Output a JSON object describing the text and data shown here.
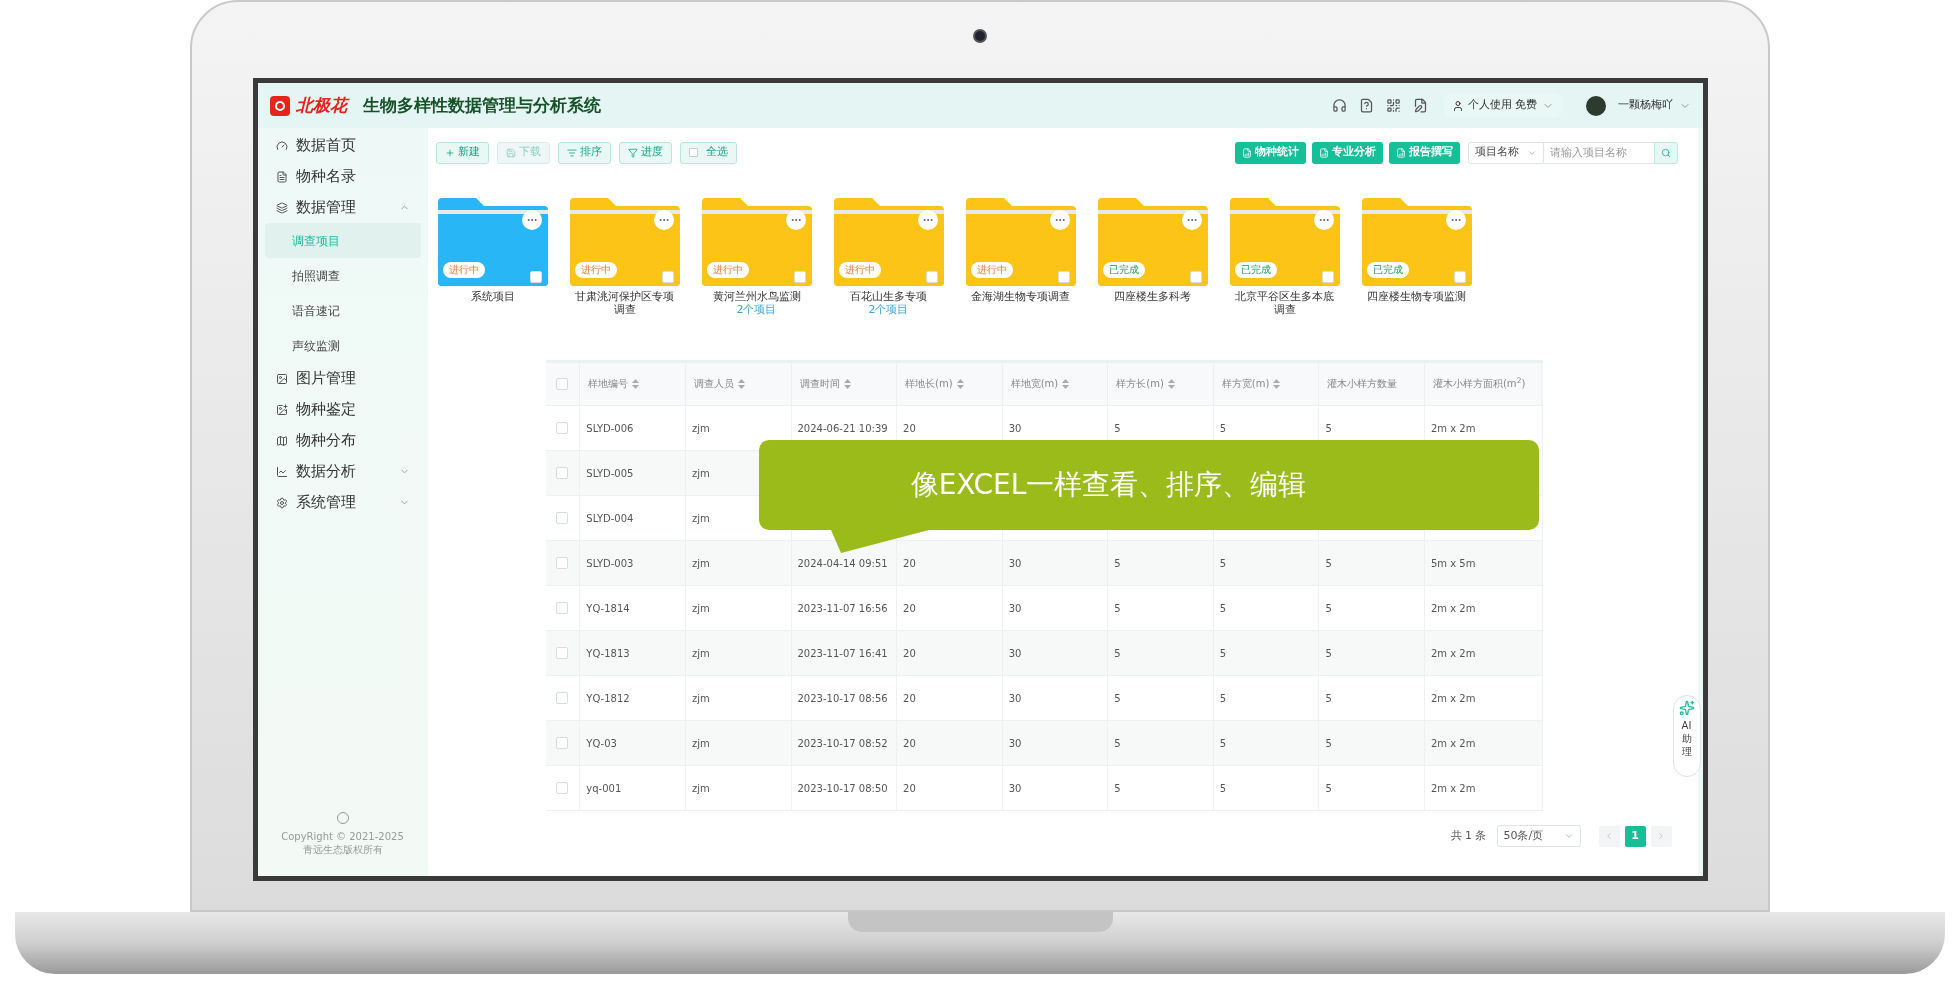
{
  "header": {
    "brand": "北极花",
    "title": "生物多样性数据管理与分析系统",
    "plan": "个人使用 免费",
    "user": "一颗杨梅吖"
  },
  "sidebar": {
    "items": [
      {
        "kind": "link",
        "label": "数据首页"
      },
      {
        "kind": "link",
        "label": "物种名录"
      },
      {
        "kind": "group",
        "label": "数据管理",
        "expanded": true,
        "children": [
          {
            "label": "调查项目",
            "selected": true
          },
          {
            "label": "拍照调查",
            "selected": false
          },
          {
            "label": "语音速记",
            "selected": false
          },
          {
            "label": "声纹监测",
            "selected": false
          }
        ]
      },
      {
        "kind": "link",
        "label": "图片管理"
      },
      {
        "kind": "link",
        "label": "物种鉴定"
      },
      {
        "kind": "link",
        "label": "物种分布"
      },
      {
        "kind": "group",
        "label": "数据分析",
        "expanded": false
      },
      {
        "kind": "group",
        "label": "系统管理",
        "expanded": false
      }
    ],
    "footer": [
      "CopyRight © 2021-2025",
      "青远生态版权所有"
    ]
  },
  "toolbar": {
    "buttons": [
      {
        "label": "新建",
        "disabled": false
      },
      {
        "label": "下载",
        "disabled": true
      },
      {
        "label": "排序",
        "disabled": false
      },
      {
        "label": "进度",
        "disabled": false
      }
    ],
    "select_all": {
      "label": "全选",
      "checked": false
    },
    "actions": [
      "物种统计",
      "专业分析",
      "报告撰写"
    ],
    "search": {
      "scope": "项目名称",
      "placeholder": "请输入项目名称"
    }
  },
  "folders": [
    {
      "name": "系统项目",
      "color": "#29b6f6",
      "status": "进行中",
      "kind": "in_progress",
      "checked": false
    },
    {
      "name": "甘肃洮河保护区专项调查",
      "color": "#fbc417",
      "status": "进行中",
      "kind": "in_progress",
      "checked": false
    },
    {
      "name": "黄河兰州水鸟监测",
      "sub": "2个项目",
      "color": "#fbc417",
      "status": "进行中",
      "kind": "in_progress",
      "checked": false
    },
    {
      "name": "百花山生多专项",
      "sub": "2个项目",
      "color": "#fbc417",
      "status": "进行中",
      "kind": "in_progress",
      "checked": false
    },
    {
      "name": "金海湖生物专项调查",
      "color": "#fbc417",
      "status": "进行中",
      "kind": "in_progress",
      "checked": false
    },
    {
      "name": "四座楼生多科考",
      "color": "#fbc417",
      "status": "已完成",
      "kind": "done",
      "checked": false
    },
    {
      "name": "北京平谷区生多本底调查",
      "color": "#fbc417",
      "status": "已完成",
      "kind": "done",
      "checked": false
    },
    {
      "name": "四座楼生物专项监测",
      "color": "#fbc417",
      "status": "已完成",
      "kind": "done",
      "checked": false
    }
  ],
  "table": {
    "header_checked": false,
    "columns": [
      {
        "label": "样地编号",
        "sortable": true
      },
      {
        "label": "调查人员",
        "sortable": true
      },
      {
        "label": "调查时间",
        "sortable": true
      },
      {
        "label": "样地长(m)",
        "sortable": true
      },
      {
        "label": "样地宽(m)",
        "sortable": true
      },
      {
        "label": "样方长(m)",
        "sortable": true
      },
      {
        "label": "样方宽(m)",
        "sortable": true
      },
      {
        "label": "灌木小样方数量",
        "sortable": false
      },
      {
        "label": "灌木小样方面积(m$^{2}$)",
        "sortable": false
      }
    ],
    "rows": [
      {
        "checked": false,
        "cells": [
          "SLYD-006",
          "zjm",
          "2024-06-21 10:39",
          "20",
          "30",
          "5",
          "5",
          "5",
          "2m x 2m"
        ]
      },
      {
        "checked": false,
        "cells": [
          "SLYD-005",
          "zjm"
        ]
      },
      {
        "checked": false,
        "cells": [
          "SLYD-004",
          "zjm"
        ]
      },
      {
        "checked": false,
        "cells": [
          "SLYD-003",
          "zjm",
          "2024-04-14 09:51",
          "20",
          "30",
          "5",
          "5",
          "5",
          "5m x 5m"
        ]
      },
      {
        "checked": false,
        "cells": [
          "YQ-1814",
          "zjm",
          "2023-11-07 16:56",
          "20",
          "30",
          "5",
          "5",
          "5",
          "2m x 2m"
        ]
      },
      {
        "checked": false,
        "cells": [
          "YQ-1813",
          "zjm",
          "2023-11-07 16:41",
          "20",
          "30",
          "5",
          "5",
          "5",
          "2m x 2m"
        ]
      },
      {
        "checked": false,
        "cells": [
          "YQ-1812",
          "zjm",
          "2023-10-17 08:56",
          "20",
          "30",
          "5",
          "5",
          "5",
          "2m x 2m"
        ]
      },
      {
        "checked": false,
        "cells": [
          "YQ-03",
          "zjm",
          "2023-10-17 08:52",
          "20",
          "30",
          "5",
          "5",
          "5",
          "2m x 2m"
        ]
      },
      {
        "checked": false,
        "cells": [
          "yq-001",
          "zjm",
          "2023-10-17 08:50",
          "20",
          "30",
          "5",
          "5",
          "5",
          "2m x 2m"
        ]
      }
    ]
  },
  "callout": {
    "text": "像EXCEL一样查看、排序、编辑"
  },
  "pagination": {
    "total": "共 1 条",
    "page_size": "50条/页",
    "pages": [
      {
        "label": "1",
        "selected": true
      }
    ]
  },
  "assistant": {
    "label": "AI助理"
  }
}
